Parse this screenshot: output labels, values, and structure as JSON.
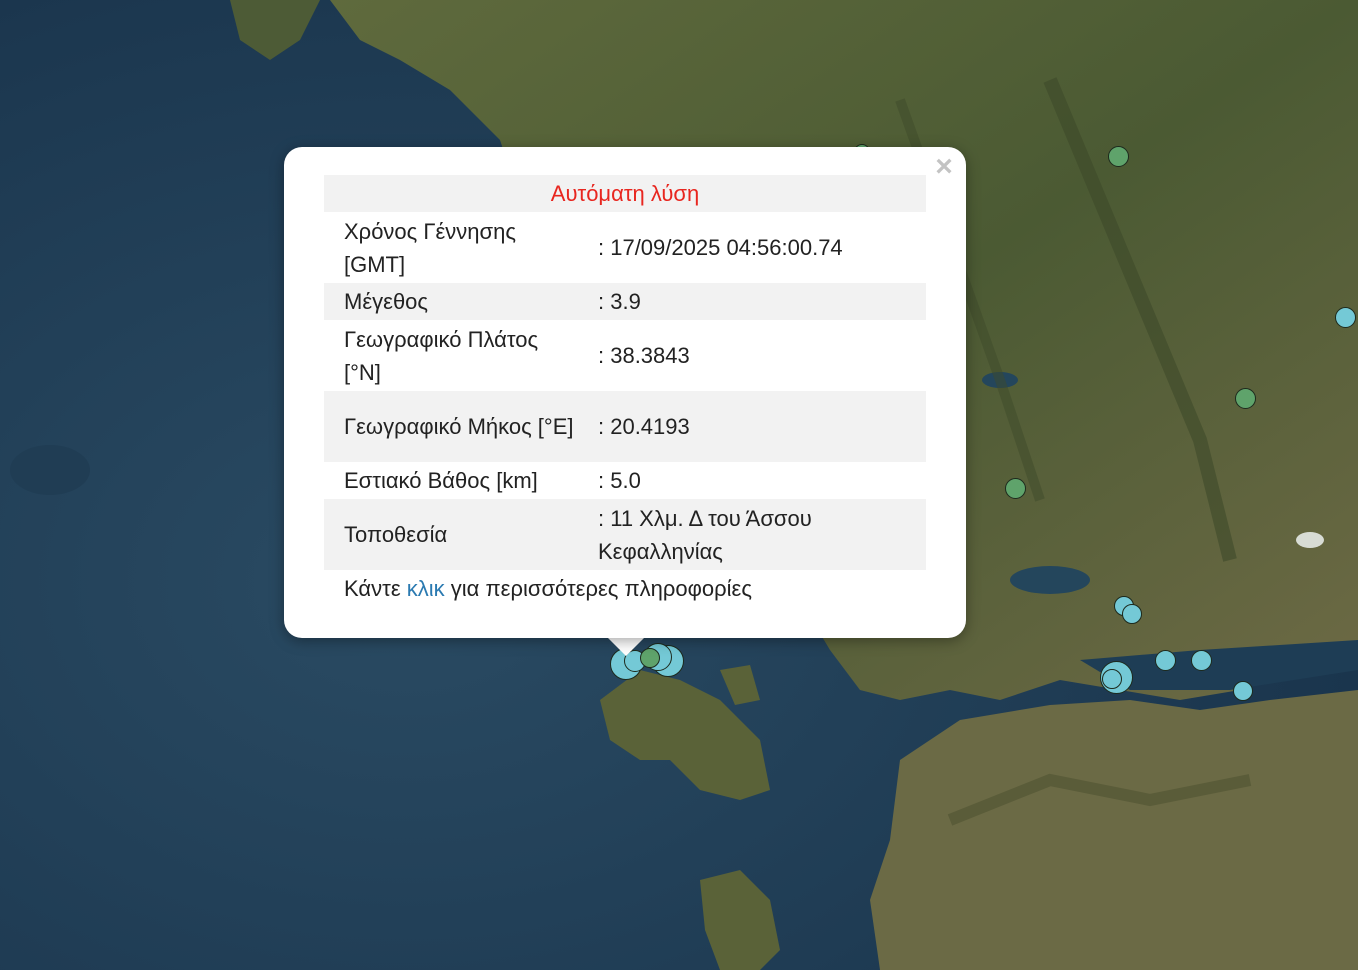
{
  "popup": {
    "close_symbol": "×",
    "status_title": "Αυτόματη λύση",
    "status_color": "#e8261f",
    "rows": [
      {
        "label": "Χρόνος Γέννησης [GMT]",
        "value": ": 17/09/2025 04:56:00.74"
      },
      {
        "label": "Μέγεθος",
        "value": ": 3.9"
      },
      {
        "label": "Γεωγραφικό Πλάτος [°N]",
        "value": ": 38.3843"
      },
      {
        "label": "Γεωγραφικό Μήκος [°E]",
        "value": ": 20.4193"
      },
      {
        "label": "Εστιακό Βάθος [km]",
        "value": ": 5.0"
      },
      {
        "label": "Τοποθεσία",
        "value": ": 11 Χλμ. Δ του Άσσου Κεφαλληνίας"
      }
    ],
    "footer_prefix": "Κάντε",
    "footer_link": "κλικ",
    "footer_suffix": "για περισσότερες πληροφορίες",
    "link_color": "#2b7ab1"
  },
  "map": {
    "marker_colors": {
      "recent": "#74c9d6",
      "older": "#5fa36b"
    }
  }
}
